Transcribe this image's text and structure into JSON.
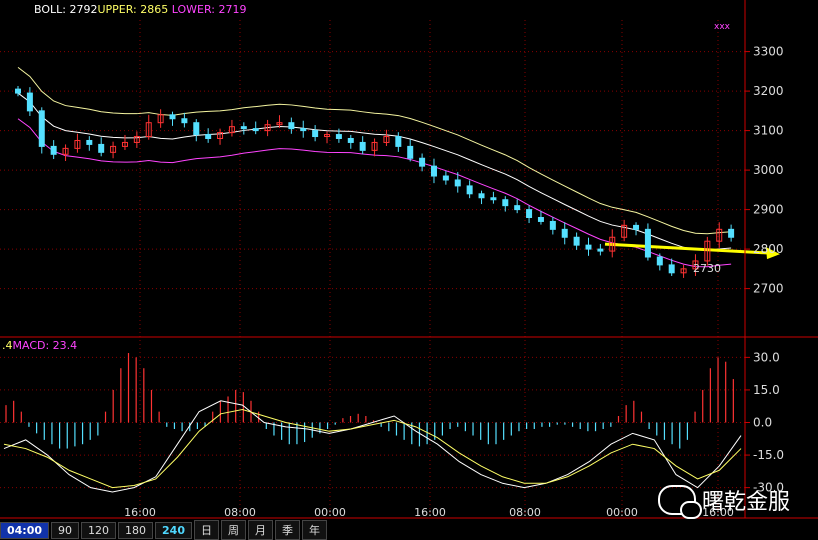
{
  "legend": {
    "boll": "BOLL: 2792",
    "upper": "UPPER: 2865",
    "lower": "LOWER: 2719",
    "macd_prefix": ".4",
    "macd": "MACD: 23.4",
    "marker": "xxx"
  },
  "annotation": "2730",
  "tabs": [
    {
      "label": "04:00",
      "active": true
    },
    {
      "label": "90"
    },
    {
      "label": "120"
    },
    {
      "label": "180"
    },
    {
      "label": "240",
      "active": false
    },
    {
      "label": "日"
    },
    {
      "label": "周"
    },
    {
      "label": "月"
    },
    {
      "label": "季"
    },
    {
      "label": "年"
    }
  ],
  "watermark": "曙乾金服",
  "chart_data": [
    {
      "type": "candlestick",
      "y_ticks": [
        3300,
        3200,
        3100,
        3000,
        2900,
        2800,
        2700
      ],
      "ylim": [
        2580,
        3380
      ],
      "x_tick_labels": [
        "16:00",
        "08:00",
        "00:00",
        "16:00",
        "08:00",
        "00:00",
        "16:00"
      ],
      "series": [
        {
          "name": "UPPER",
          "color": "#f5f5a0"
        },
        {
          "name": "BOLL",
          "color": "#ffffff"
        },
        {
          "name": "LOWER",
          "color": "#ff44ff"
        }
      ],
      "last_values": {
        "boll": 2792,
        "upper": 2865,
        "lower": 2719
      },
      "low_marker": 2730,
      "arrow_level": 2800,
      "close_path": [
        3195,
        3150,
        3060,
        3040,
        3055,
        3075,
        3065,
        3045,
        3060,
        3070,
        3085,
        3120,
        3140,
        3130,
        3120,
        3090,
        3080,
        3095,
        3110,
        3105,
        3100,
        3115,
        3120,
        3105,
        3100,
        3085,
        3090,
        3080,
        3070,
        3050,
        3070,
        3085,
        3060,
        3030,
        3010,
        2985,
        2975,
        2960,
        2940,
        2930,
        2925,
        2910,
        2900,
        2880,
        2870,
        2850,
        2830,
        2810,
        2800,
        2795,
        2830,
        2860,
        2850,
        2780,
        2760,
        2740,
        2750,
        2770,
        2820,
        2850,
        2830
      ]
    },
    {
      "type": "bar",
      "title": "MACD: 23.4",
      "y_ticks": [
        30.0,
        15.0,
        0.0,
        -15.0,
        -30.0
      ],
      "ylim": [
        -38,
        38
      ],
      "values": [
        8,
        10,
        5,
        -2,
        -5,
        -8,
        -10,
        -12,
        -12,
        -11,
        -10,
        -8,
        -6,
        5,
        15,
        25,
        32,
        30,
        25,
        15,
        5,
        -2,
        -3,
        -4,
        -4,
        -3,
        -2,
        5,
        10,
        12,
        15,
        14,
        10,
        5,
        -3,
        -6,
        -8,
        -10,
        -10,
        -9,
        -7,
        -5,
        -3,
        -1,
        2,
        3,
        4,
        3,
        1,
        -2,
        -4,
        -6,
        -8,
        -10,
        -11,
        -10,
        -8,
        -6,
        -3,
        -2,
        -4,
        -6,
        -8,
        -10,
        -10,
        -8,
        -6,
        -4,
        -3,
        -3,
        -2,
        -2,
        -1,
        -1,
        -2,
        -3,
        -4,
        -4,
        -3,
        -2,
        3,
        8,
        10,
        5,
        -3,
        -6,
        -8,
        -10,
        -12,
        -8,
        5,
        15,
        25,
        30,
        28,
        20
      ]
    }
  ]
}
